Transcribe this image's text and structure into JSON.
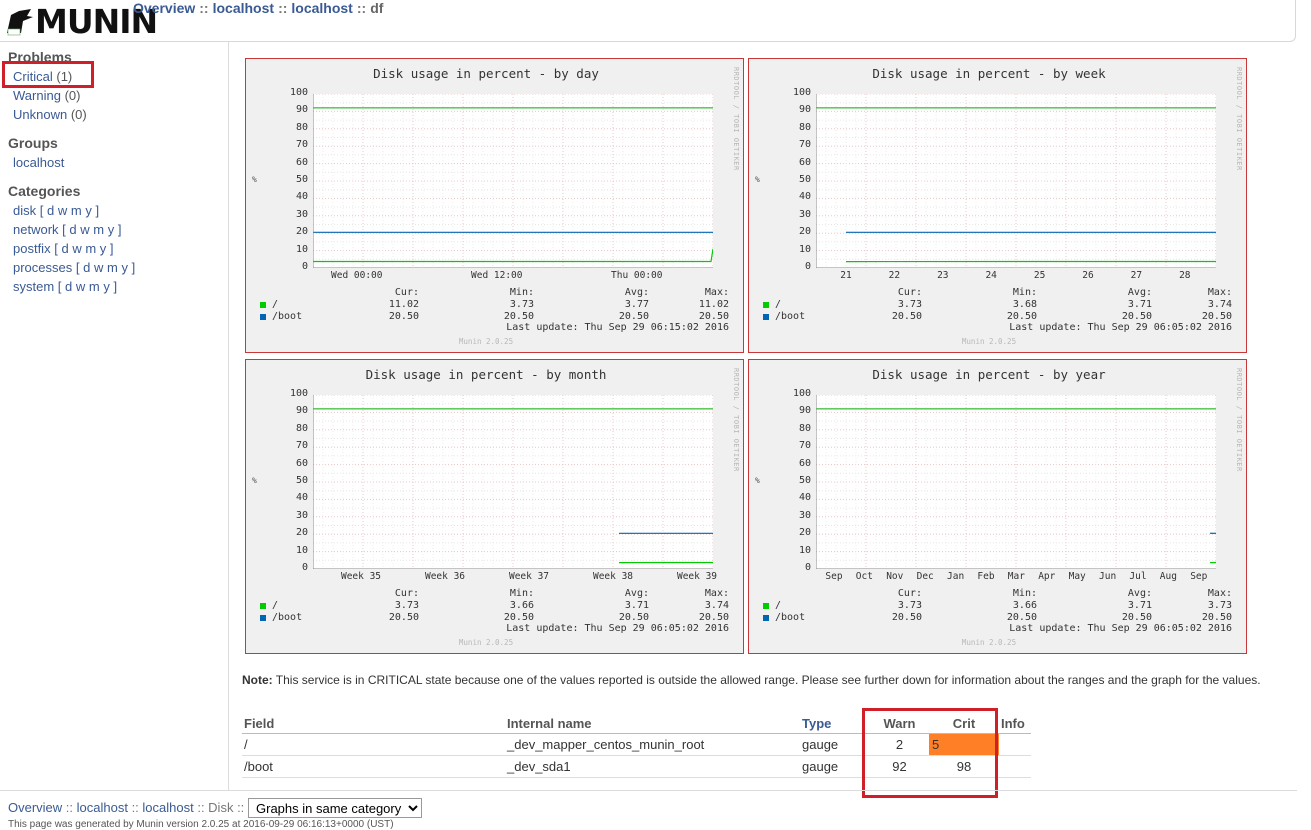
{
  "header": {
    "logo_text": "MUNIN",
    "crumbs": [
      "Overview",
      "localhost",
      "localhost",
      "df"
    ],
    "sep": "::"
  },
  "sidebar": {
    "problems_heading": "Problems",
    "problems": [
      {
        "label": "Critical",
        "count": "(1)"
      },
      {
        "label": "Warning",
        "count": "(0)"
      },
      {
        "label": "Unknown",
        "count": "(0)"
      }
    ],
    "groups_heading": "Groups",
    "groups": [
      "localhost"
    ],
    "categories_heading": "Categories",
    "categories": [
      "disk",
      "network",
      "postfix",
      "processes",
      "system"
    ],
    "period_links": [
      "d",
      "w",
      "m",
      "y"
    ]
  },
  "graphs": [
    {
      "title": "Disk usage in percent - by day",
      "side_text": "RRDTOOL / TOBI OETIKER",
      "ylabel": "%",
      "legend_headers": [
        "Cur:",
        "Min:",
        "Avg:",
        "Max:"
      ],
      "legend": [
        {
          "name": "/",
          "color": "#00cc00",
          "cur": "11.02",
          "min": "3.73",
          "avg": "3.77",
          "max": "11.02"
        },
        {
          "name": "/boot",
          "color": "#0066b3",
          "cur": "20.50",
          "min": "20.50",
          "avg": "20.50",
          "max": "20.50"
        }
      ],
      "last_update": "Last update: Thu Sep 29 06:15:02 2016",
      "version": "Munin 2.0.25",
      "ticks": [
        "Wed 00:00",
        "Wed 12:00",
        "Thu 00:00"
      ]
    },
    {
      "title": "Disk usage in percent - by week",
      "side_text": "RRDTOOL / TOBI OETIKER",
      "ylabel": "%",
      "legend_headers": [
        "Cur:",
        "Min:",
        "Avg:",
        "Max:"
      ],
      "legend": [
        {
          "name": "/",
          "color": "#00cc00",
          "cur": "3.73",
          "min": "3.68",
          "avg": "3.71",
          "max": "3.74"
        },
        {
          "name": "/boot",
          "color": "#0066b3",
          "cur": "20.50",
          "min": "20.50",
          "avg": "20.50",
          "max": "20.50"
        }
      ],
      "last_update": "Last update: Thu Sep 29 06:05:02 2016",
      "version": "Munin 2.0.25",
      "ticks": [
        "21",
        "22",
        "23",
        "24",
        "25",
        "26",
        "27",
        "28"
      ]
    },
    {
      "title": "Disk usage in percent - by month",
      "side_text": "RRDTOOL / TOBI OETIKER",
      "ylabel": "%",
      "legend_headers": [
        "Cur:",
        "Min:",
        "Avg:",
        "Max:"
      ],
      "legend": [
        {
          "name": "/",
          "color": "#00cc00",
          "cur": "3.73",
          "min": "3.66",
          "avg": "3.71",
          "max": "3.74"
        },
        {
          "name": "/boot",
          "color": "#0066b3",
          "cur": "20.50",
          "min": "20.50",
          "avg": "20.50",
          "max": "20.50"
        }
      ],
      "last_update": "Last update: Thu Sep 29 06:05:02 2016",
      "version": "Munin 2.0.25",
      "ticks": [
        "Week 35",
        "Week 36",
        "Week 37",
        "Week 38",
        "Week 39"
      ]
    },
    {
      "title": "Disk usage in percent - by year",
      "side_text": "RRDTOOL / TOBI OETIKER",
      "ylabel": "%",
      "legend_headers": [
        "Cur:",
        "Min:",
        "Avg:",
        "Max:"
      ],
      "legend": [
        {
          "name": "/",
          "color": "#00cc00",
          "cur": "3.73",
          "min": "3.66",
          "avg": "3.71",
          "max": "3.73"
        },
        {
          "name": "/boot",
          "color": "#0066b3",
          "cur": "20.50",
          "min": "20.50",
          "avg": "20.50",
          "max": "20.50"
        }
      ],
      "last_update": "Last update: Thu Sep 29 06:05:02 2016",
      "version": "Munin 2.0.25",
      "ticks": [
        "Sep",
        "Oct",
        "Nov",
        "Dec",
        "Jan",
        "Feb",
        "Mar",
        "Apr",
        "May",
        "Jun",
        "Jul",
        "Aug",
        "Sep"
      ]
    }
  ],
  "chart_data": [
    {
      "type": "line",
      "title": "Disk usage in percent - by day",
      "ylabel": "%",
      "ylim": [
        0,
        100
      ],
      "yticks": [
        0,
        10,
        20,
        30,
        40,
        50,
        60,
        70,
        80,
        90,
        100
      ],
      "x": [
        0,
        0.995,
        1
      ],
      "series": [
        {
          "name": "/",
          "values": [
            3.73,
            3.73,
            11.02
          ]
        },
        {
          "name": "/boot",
          "values": [
            20.5,
            20.5,
            20.5
          ]
        }
      ],
      "warn_line": 92
    },
    {
      "type": "line",
      "title": "Disk usage in percent - by week",
      "ylabel": "%",
      "ylim": [
        0,
        100
      ],
      "yticks": [
        0,
        10,
        20,
        30,
        40,
        50,
        60,
        70,
        80,
        90,
        100
      ],
      "x": [
        0.075,
        0.5,
        0.55,
        1
      ],
      "series": [
        {
          "name": "/",
          "values": [
            3.68,
            3.71,
            3.74,
            3.73
          ]
        },
        {
          "name": "/boot",
          "values": [
            20.5,
            20.5,
            20.5,
            20.5
          ]
        }
      ],
      "warn_line": 92
    },
    {
      "type": "line",
      "title": "Disk usage in percent - by month",
      "ylabel": "%",
      "ylim": [
        0,
        100
      ],
      "yticks": [
        0,
        10,
        20,
        30,
        40,
        50,
        60,
        70,
        80,
        90,
        100
      ],
      "x": [
        0.765,
        0.87,
        1
      ],
      "series": [
        {
          "name": "/",
          "values": [
            3.66,
            3.71,
            3.74
          ]
        },
        {
          "name": "/boot",
          "values": [
            20.5,
            20.5,
            20.5
          ]
        }
      ],
      "warn_line": 92
    },
    {
      "type": "line",
      "title": "Disk usage in percent - by year",
      "ylabel": "%",
      "ylim": [
        0,
        100
      ],
      "yticks": [
        0,
        10,
        20,
        30,
        40,
        50,
        60,
        70,
        80,
        90,
        100
      ],
      "x": [
        0.985,
        1
      ],
      "series": [
        {
          "name": "/",
          "values": [
            3.66,
            3.73
          ]
        },
        {
          "name": "/boot",
          "values": [
            20.5,
            20.5
          ]
        }
      ],
      "warn_line": 92
    }
  ],
  "note": {
    "bold": "Note:",
    "text": "This service is in CRITICAL state because one of the values reported is outside the allowed range. Please see further down for information about the ranges and the graph for the values."
  },
  "table": {
    "headers": [
      "Field",
      "Internal name",
      "Type",
      "Warn",
      "Crit",
      "Info"
    ],
    "rows": [
      {
        "field": "/",
        "internal": "_dev_mapper_centos_munin_root",
        "type": "gauge",
        "warn": "2",
        "crit": "5",
        "info": ""
      },
      {
        "field": "/boot",
        "internal": "_dev_sda1",
        "type": "gauge",
        "warn": "92",
        "crit": "98",
        "info": ""
      }
    ]
  },
  "footer": {
    "crumbs": [
      "Overview",
      "localhost",
      "localhost",
      "Disk"
    ],
    "select_value": "Graphs in same category",
    "generated": "This page was generated by Munin version 2.0.25 at 2016-09-29 06:16:13+0000 (UST)"
  },
  "colors": {
    "link": "#3a5a94",
    "critical": "#d11f2a",
    "crit_cell": "#ff7f27",
    "root_series": "#00cc00",
    "boot_series": "#0066b3"
  }
}
